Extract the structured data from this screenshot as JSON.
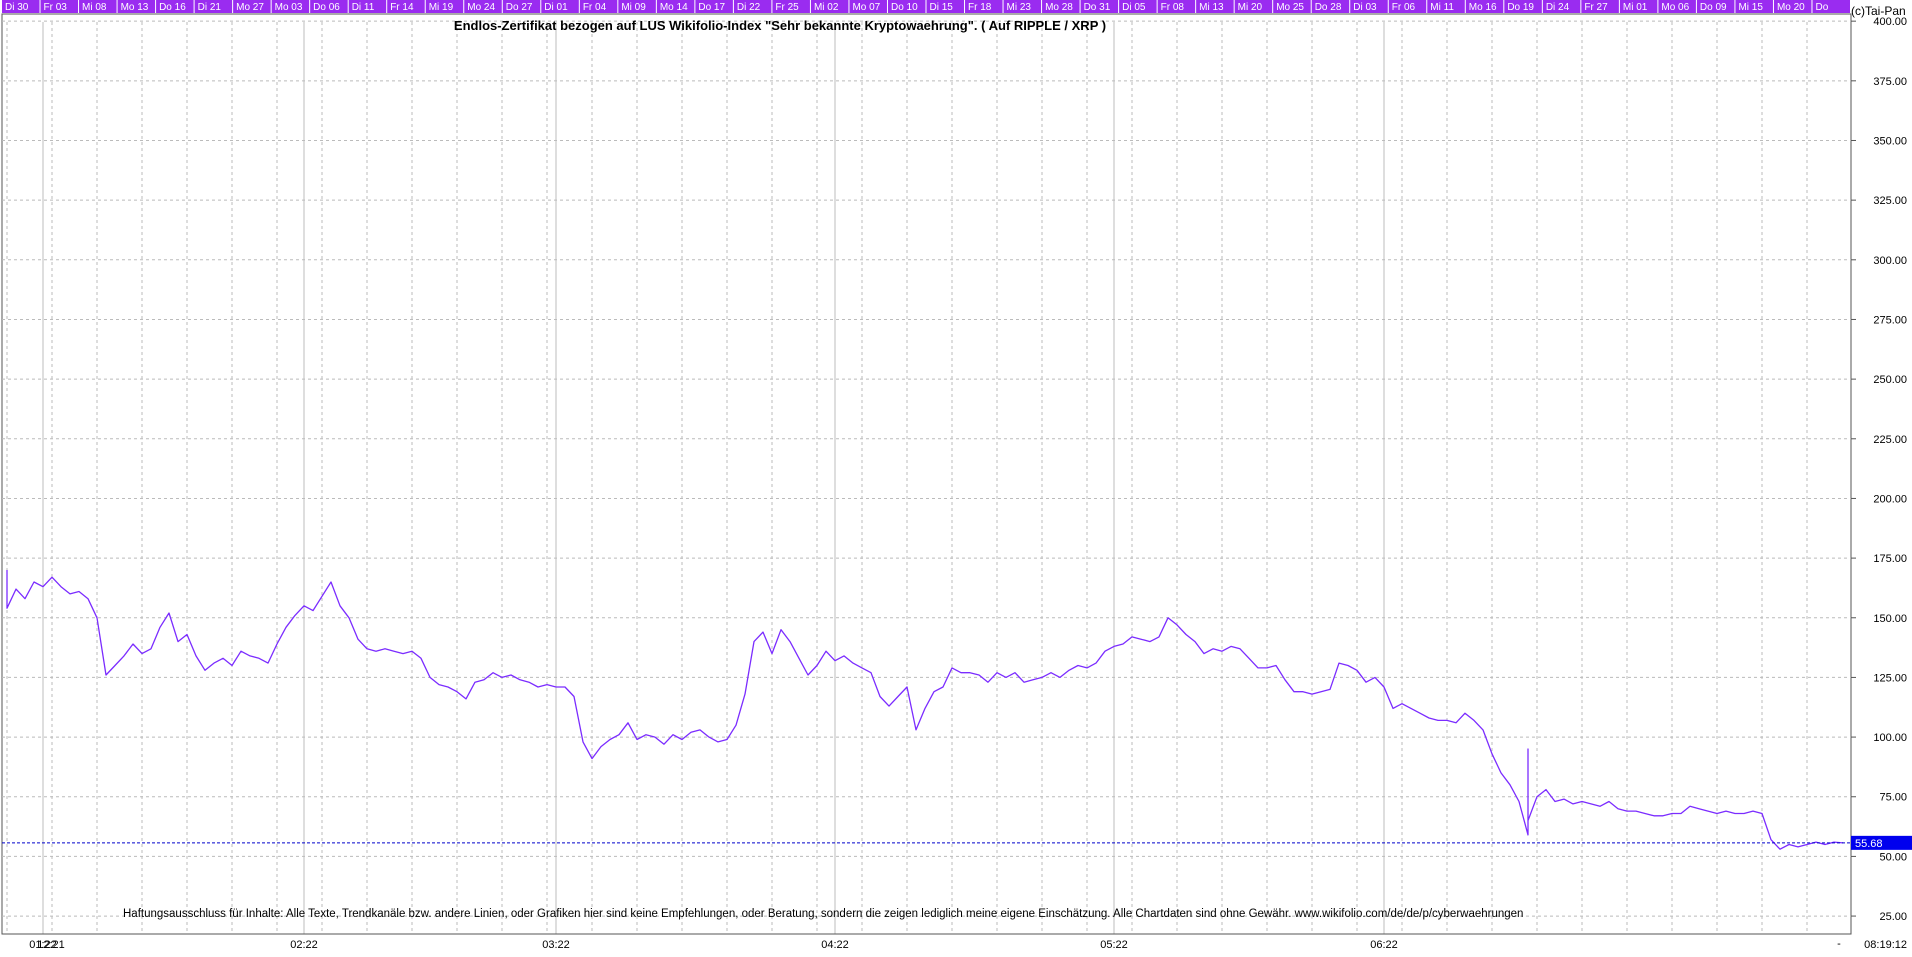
{
  "window": {
    "corner_label": "(c)Tai-Pan"
  },
  "date_strip": [
    "Di 30",
    "Fr 03",
    "Mi 08",
    "Mo 13",
    "Do 16",
    "Di 21",
    "Mo 27",
    "Mo 03",
    "Do 06",
    "Di 11",
    "Fr 14",
    "Mi 19",
    "Mo 24",
    "Do 27",
    "Di 01",
    "Fr 04",
    "Mi 09",
    "Mo 14",
    "Do 17",
    "Di 22",
    "Fr 25",
    "Mi 02",
    "Mo 07",
    "Do 10",
    "Di 15",
    "Fr 18",
    "Mi 23",
    "Mo 28",
    "Do 31",
    "Di 05",
    "Fr 08",
    "Mi 13",
    "Mi 20",
    "Mo 25",
    "Do 28",
    "Di 03",
    "Fr 06",
    "Mi 11",
    "Mo 16",
    "Do 19",
    "Di 24",
    "Fr 27",
    "Mi 01",
    "Mo 06",
    "Do 09",
    "Mi 15",
    "Mo 20",
    "Do"
  ],
  "colors": {
    "series": "#7b2cff",
    "strip": "#9a2cf0",
    "grid": "#bbbbbb",
    "last_price_bg": "#0000ee"
  },
  "chart_data": {
    "type": "line",
    "title": "Endlos-Zertifikat bezogen auf LUS Wikifolio-Index \"Sehr bekannte Kryptowaehrung\". ( Auf RIPPLE / XRP )",
    "disclaimer": "Haftungsausschluss für Inhalte: Alle Texte, Trendkanäle bzw. andere Linien, oder Grafiken hier sind keine Empfehlungen, oder Beratung, sondern die zeigen lediglich meine eigene Einschätzung. Alle Chartdaten sind ohne Gewähr.  www.wikifolio.com/de/de/p/cyberwaehrungen",
    "y_axis": {
      "min": 20,
      "max": 403,
      "ticks": [
        25,
        50,
        75,
        100,
        125,
        150,
        175,
        200,
        225,
        250,
        275,
        300,
        325,
        350,
        375,
        400
      ],
      "tick_labels": [
        "25.00",
        "50.00",
        "75.00",
        "100.00",
        "125.00",
        "150.00",
        "175.00",
        "200.00",
        "225.00",
        "250.00",
        "275.00",
        "300.00",
        "325.00",
        "350.00",
        "375.00",
        "400.00"
      ]
    },
    "x_axis": {
      "start": "2021-12-30",
      "end": "2022-06-24",
      "month_ticks": [
        {
          "date": "2021-12-30",
          "label": "12:21"
        },
        {
          "date": "2022-01-03",
          "label": "01:22"
        },
        {
          "date": "2022-02-01",
          "label": "02:22"
        },
        {
          "date": "2022-03-01",
          "label": "03:22"
        },
        {
          "date": "2022-04-01",
          "label": "04:22"
        },
        {
          "date": "2022-05-02",
          "label": "05:22"
        },
        {
          "date": "2022-06-01",
          "label": "06:22"
        }
      ],
      "end_label": "08:19:12",
      "end_marker": "-"
    },
    "grid": true,
    "last_value": 55.68,
    "last_value_label": "55.68",
    "series": [
      {
        "points": [
          [
            "2021-12-30",
            170
          ],
          [
            "2021-12-30",
            154
          ],
          [
            "2021-12-31",
            162
          ],
          [
            "2022-01-01",
            158
          ],
          [
            "2022-01-02",
            165
          ],
          [
            "2022-01-03",
            163
          ],
          [
            "2022-01-04",
            167
          ],
          [
            "2022-01-05",
            163
          ],
          [
            "2022-01-06",
            160
          ],
          [
            "2022-01-07",
            161
          ],
          [
            "2022-01-08",
            158
          ],
          [
            "2022-01-09",
            150
          ],
          [
            "2022-01-10",
            126
          ],
          [
            "2022-01-11",
            130
          ],
          [
            "2022-01-12",
            134
          ],
          [
            "2022-01-13",
            139
          ],
          [
            "2022-01-14",
            135
          ],
          [
            "2022-01-15",
            137
          ],
          [
            "2022-01-16",
            146
          ],
          [
            "2022-01-17",
            152
          ],
          [
            "2022-01-18",
            140
          ],
          [
            "2022-01-19",
            143
          ],
          [
            "2022-01-20",
            134
          ],
          [
            "2022-01-21",
            128
          ],
          [
            "2022-01-22",
            131
          ],
          [
            "2022-01-23",
            133
          ],
          [
            "2022-01-24",
            130
          ],
          [
            "2022-01-25",
            136
          ],
          [
            "2022-01-26",
            134
          ],
          [
            "2022-01-27",
            133
          ],
          [
            "2022-01-28",
            131
          ],
          [
            "2022-01-29",
            139
          ],
          [
            "2022-01-30",
            146
          ],
          [
            "2022-01-31",
            151
          ],
          [
            "2022-02-01",
            155
          ],
          [
            "2022-02-02",
            153
          ],
          [
            "2022-02-03",
            159
          ],
          [
            "2022-02-04",
            165
          ],
          [
            "2022-02-05",
            155
          ],
          [
            "2022-02-06",
            150
          ],
          [
            "2022-02-07",
            141
          ],
          [
            "2022-02-08",
            137
          ],
          [
            "2022-02-09",
            136
          ],
          [
            "2022-02-10",
            137
          ],
          [
            "2022-02-11",
            136
          ],
          [
            "2022-02-12",
            135
          ],
          [
            "2022-02-13",
            136
          ],
          [
            "2022-02-14",
            133
          ],
          [
            "2022-02-15",
            125
          ],
          [
            "2022-02-16",
            122
          ],
          [
            "2022-02-17",
            121
          ],
          [
            "2022-02-18",
            119
          ],
          [
            "2022-02-19",
            116
          ],
          [
            "2022-02-20",
            123
          ],
          [
            "2022-02-21",
            124
          ],
          [
            "2022-02-22",
            127
          ],
          [
            "2022-02-23",
            125
          ],
          [
            "2022-02-24",
            126
          ],
          [
            "2022-02-25",
            124
          ],
          [
            "2022-02-26",
            123
          ],
          [
            "2022-02-27",
            121
          ],
          [
            "2022-02-28",
            122
          ],
          [
            "2022-03-01",
            121
          ],
          [
            "2022-03-02",
            121
          ],
          [
            "2022-03-03",
            117
          ],
          [
            "2022-03-04",
            98
          ],
          [
            "2022-03-05",
            91
          ],
          [
            "2022-03-06",
            96
          ],
          [
            "2022-03-07",
            99
          ],
          [
            "2022-03-08",
            101
          ],
          [
            "2022-03-09",
            106
          ],
          [
            "2022-03-10",
            99
          ],
          [
            "2022-03-11",
            101
          ],
          [
            "2022-03-12",
            100
          ],
          [
            "2022-03-13",
            97
          ],
          [
            "2022-03-14",
            101
          ],
          [
            "2022-03-15",
            99
          ],
          [
            "2022-03-16",
            102
          ],
          [
            "2022-03-17",
            103
          ],
          [
            "2022-03-18",
            100
          ],
          [
            "2022-03-19",
            98
          ],
          [
            "2022-03-20",
            99
          ],
          [
            "2022-03-21",
            105
          ],
          [
            "2022-03-22",
            118
          ],
          [
            "2022-03-23",
            140
          ],
          [
            "2022-03-24",
            144
          ],
          [
            "2022-03-25",
            135
          ],
          [
            "2022-03-26",
            145
          ],
          [
            "2022-03-27",
            140
          ],
          [
            "2022-03-28",
            133
          ],
          [
            "2022-03-29",
            126
          ],
          [
            "2022-03-30",
            130
          ],
          [
            "2022-03-31",
            136
          ],
          [
            "2022-04-01",
            132
          ],
          [
            "2022-04-02",
            134
          ],
          [
            "2022-04-03",
            131
          ],
          [
            "2022-04-04",
            129
          ],
          [
            "2022-04-05",
            127
          ],
          [
            "2022-04-06",
            117
          ],
          [
            "2022-04-07",
            113
          ],
          [
            "2022-04-08",
            117
          ],
          [
            "2022-04-09",
            121
          ],
          [
            "2022-04-10",
            103
          ],
          [
            "2022-04-11",
            112
          ],
          [
            "2022-04-12",
            119
          ],
          [
            "2022-04-13",
            121
          ],
          [
            "2022-04-14",
            129
          ],
          [
            "2022-04-15",
            127
          ],
          [
            "2022-04-16",
            127
          ],
          [
            "2022-04-17",
            126
          ],
          [
            "2022-04-18",
            123
          ],
          [
            "2022-04-19",
            127
          ],
          [
            "2022-04-20",
            125
          ],
          [
            "2022-04-21",
            127
          ],
          [
            "2022-04-22",
            123
          ],
          [
            "2022-04-23",
            124
          ],
          [
            "2022-04-24",
            125
          ],
          [
            "2022-04-25",
            127
          ],
          [
            "2022-04-26",
            125
          ],
          [
            "2022-04-27",
            128
          ],
          [
            "2022-04-28",
            130
          ],
          [
            "2022-04-29",
            129
          ],
          [
            "2022-04-30",
            131
          ],
          [
            "2022-05-01",
            136
          ],
          [
            "2022-05-02",
            138
          ],
          [
            "2022-05-03",
            139
          ],
          [
            "2022-05-04",
            142
          ],
          [
            "2022-05-05",
            141
          ],
          [
            "2022-05-06",
            140
          ],
          [
            "2022-05-07",
            142
          ],
          [
            "2022-05-08",
            150
          ],
          [
            "2022-05-09",
            147
          ],
          [
            "2022-05-10",
            143
          ],
          [
            "2022-05-11",
            140
          ],
          [
            "2022-05-12",
            135
          ],
          [
            "2022-05-13",
            137
          ],
          [
            "2022-05-14",
            136
          ],
          [
            "2022-05-15",
            138
          ],
          [
            "2022-05-16",
            137
          ],
          [
            "2022-05-17",
            133
          ],
          [
            "2022-05-18",
            129
          ],
          [
            "2022-05-19",
            129
          ],
          [
            "2022-05-20",
            130
          ],
          [
            "2022-05-21",
            124
          ],
          [
            "2022-05-22",
            119
          ],
          [
            "2022-05-23",
            119
          ],
          [
            "2022-05-24",
            118
          ],
          [
            "2022-05-25",
            119
          ],
          [
            "2022-05-26",
            120
          ],
          [
            "2022-05-27",
            131
          ],
          [
            "2022-05-28",
            130
          ],
          [
            "2022-05-29",
            128
          ],
          [
            "2022-05-30",
            123
          ],
          [
            "2022-05-31",
            125
          ],
          [
            "2022-06-01",
            121
          ],
          [
            "2022-06-02",
            112
          ],
          [
            "2022-06-03",
            114
          ],
          [
            "2022-06-04",
            112
          ],
          [
            "2022-06-05",
            110
          ],
          [
            "2022-06-06",
            108
          ],
          [
            "2022-06-07",
            107
          ],
          [
            "2022-06-08",
            107
          ],
          [
            "2022-06-09",
            106
          ],
          [
            "2022-06-10",
            110
          ],
          [
            "2022-06-11",
            107
          ],
          [
            "2022-06-12",
            103
          ],
          [
            "2022-06-13",
            93
          ],
          [
            "2022-06-14",
            85
          ],
          [
            "2022-06-15",
            80
          ],
          [
            "2022-06-16",
            73
          ],
          [
            "2022-06-17",
            59
          ],
          [
            "2022-06-17",
            95
          ],
          [
            "2022-06-17",
            65
          ],
          [
            "2022-06-18",
            75
          ],
          [
            "2022-06-19",
            78
          ],
          [
            "2022-06-20",
            73
          ],
          [
            "2022-06-21",
            74
          ],
          [
            "2022-06-22",
            72
          ],
          [
            "2022-06-23",
            73
          ],
          [
            "2022-06-24",
            72
          ],
          [
            "2022-06-25",
            71
          ],
          [
            "2022-06-26",
            73
          ],
          [
            "2022-06-27",
            70
          ],
          [
            "2022-06-28",
            69
          ],
          [
            "2022-06-29",
            69
          ],
          [
            "2022-06-30",
            68
          ],
          [
            "2022-07-01",
            67
          ],
          [
            "2022-07-02",
            67
          ],
          [
            "2022-07-03",
            68
          ],
          [
            "2022-07-04",
            68
          ],
          [
            "2022-07-05",
            71
          ],
          [
            "2022-07-06",
            70
          ],
          [
            "2022-07-07",
            69
          ],
          [
            "2022-07-08",
            68
          ],
          [
            "2022-07-09",
            69
          ],
          [
            "2022-07-10",
            68
          ],
          [
            "2022-07-11",
            68
          ],
          [
            "2022-07-12",
            69
          ],
          [
            "2022-07-13",
            68
          ],
          [
            "2022-07-14",
            57
          ],
          [
            "2022-07-15",
            53
          ],
          [
            "2022-07-16",
            55
          ],
          [
            "2022-07-17",
            54
          ],
          [
            "2022-07-18",
            55
          ],
          [
            "2022-07-19",
            56
          ],
          [
            "2022-07-20",
            55
          ],
          [
            "2022-07-21",
            56
          ],
          [
            "2022-07-22",
            55.68
          ]
        ]
      }
    ]
  }
}
